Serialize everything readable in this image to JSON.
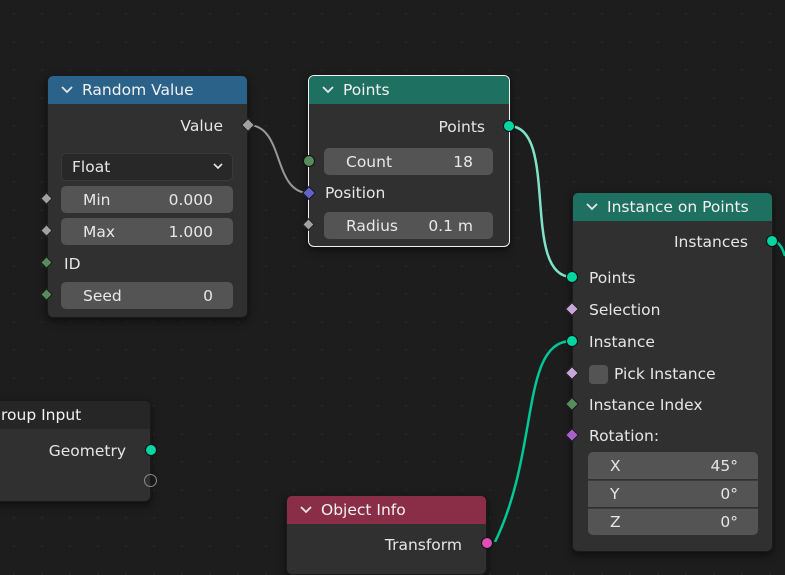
{
  "colors": {
    "random_value_header": "#2b6289",
    "points_header": "#1e7060",
    "instance_header": "#1e7060",
    "group_input_header": "#262626",
    "object_info_header": "#8a2e48",
    "geometry_socket": "#00d6a3",
    "float_socket": "#a1a1a1",
    "int_socket": "#598c5c",
    "vector_socket": "#6363c7",
    "rotation_socket": "#a663c7",
    "matrix_socket": "#e04db5"
  },
  "random_value": {
    "title": "Random Value",
    "output_value": "Value",
    "data_type": "Float",
    "min_label": "Min",
    "min_value": "0.000",
    "max_label": "Max",
    "max_value": "1.000",
    "id_label": "ID",
    "seed_label": "Seed",
    "seed_value": "0"
  },
  "points": {
    "title": "Points",
    "output_points": "Points",
    "count_label": "Count",
    "count_value": "18",
    "position_label": "Position",
    "radius_label": "Radius",
    "radius_value": "0.1 m"
  },
  "instance_on_points": {
    "title": "Instance on Points",
    "output_instances": "Instances",
    "points_label": "Points",
    "selection_label": "Selection",
    "instance_label": "Instance",
    "pick_instance_label": "Pick Instance",
    "instance_index_label": "Instance Index",
    "rotation_label": "Rotation:",
    "rot_x_label": "X",
    "rot_x_value": "45°",
    "rot_y_label": "Y",
    "rot_y_value": "0°",
    "rot_z_label": "Z",
    "rot_z_value": "0°"
  },
  "group_input": {
    "title": "roup Input",
    "geometry_label": "Geometry"
  },
  "object_info": {
    "title": "Object Info",
    "transform_label": "Transform"
  }
}
